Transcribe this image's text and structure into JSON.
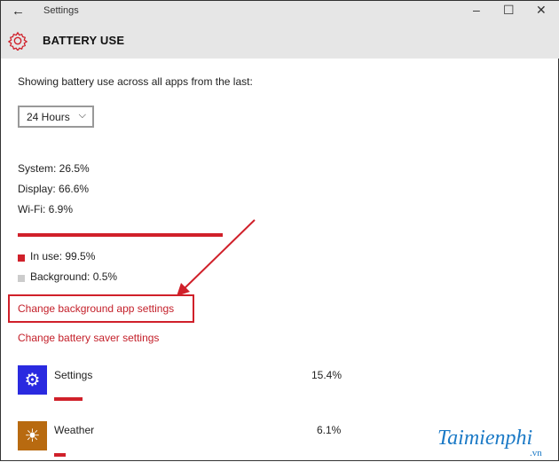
{
  "window": {
    "back_icon": "arrow-left-icon",
    "title": "Settings",
    "minimize": "–",
    "maximize": "☐",
    "close": "✕"
  },
  "page": {
    "title": "BATTERY USE",
    "icon": "gear-icon"
  },
  "intro": "Showing battery use across all apps from the last:",
  "period": {
    "selected": "24 Hours"
  },
  "breakdown": [
    "System: 26.5%",
    "Display: 66.6%",
    "Wi-Fi: 6.9%"
  ],
  "usage": {
    "in_use_label": "In use: 99.5%",
    "in_use_percent": 99.5,
    "background_label": "Background: 0.5%",
    "background_percent": 0.5
  },
  "links": {
    "background_apps": "Change background app settings",
    "battery_saver": "Change battery saver settings"
  },
  "apps": [
    {
      "name": "Settings",
      "percent_label": "15.4%",
      "percent": 15.4,
      "color": "#2a2ae0",
      "icon": "gear-icon"
    },
    {
      "name": "Weather",
      "percent_label": "6.1%",
      "percent": 6.1,
      "color": "#b86a10",
      "icon": "sun-icon"
    }
  ],
  "colors": {
    "accent": "#d0202a",
    "link": "#c4202a"
  },
  "watermark": {
    "text": "Taimienphi",
    "suffix": ".vn"
  }
}
